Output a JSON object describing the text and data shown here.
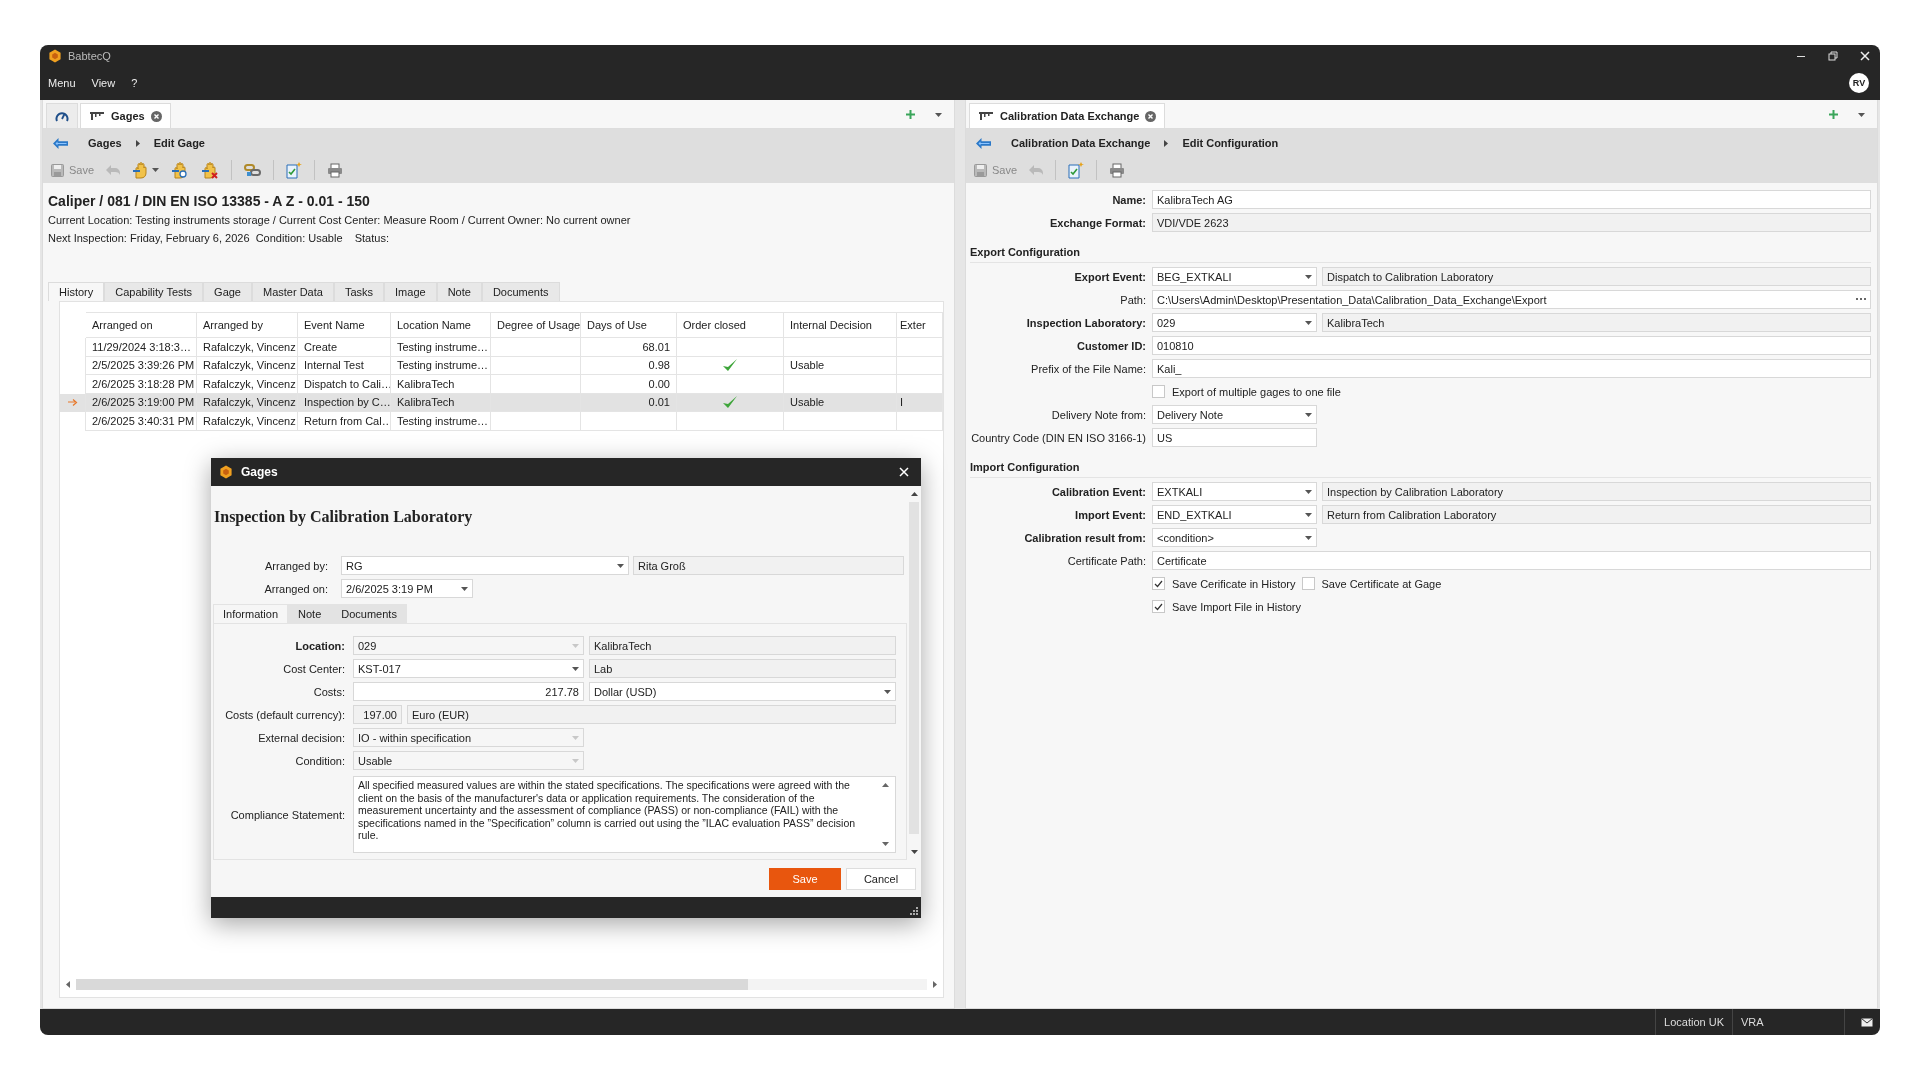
{
  "window": {
    "title": "BabtecQ",
    "menu": [
      "Menu",
      "View",
      "?"
    ],
    "avatar": "RV"
  },
  "gages_panel": {
    "tabs": [
      {
        "kind": "home",
        "selected": false
      },
      {
        "kind": "page",
        "label": "Gages",
        "selected": true
      }
    ],
    "breadcrumb": [
      "Gages",
      "Edit Gage"
    ],
    "toolbar": {
      "save": "Save"
    },
    "heading": "Caliper / 081 / DIN EN ISO 13385 - A Z - 0.01 - 150",
    "info_lines": [
      "Current Location: Testing instruments storage / Current Cost Center: Measure Room / Current Owner: No current owner",
      "Next Inspection: Friday, February 6, 2026  Condition: Usable    Status:"
    ],
    "detail_tabs": [
      {
        "label": "History",
        "selected": true
      },
      {
        "label": "Capability Tests",
        "selected": false
      },
      {
        "label": "Gage",
        "selected": false
      },
      {
        "label": "Master Data",
        "selected": false
      },
      {
        "label": "Tasks",
        "selected": false
      },
      {
        "label": "Image",
        "selected": false
      },
      {
        "label": "Note",
        "selected": false
      },
      {
        "label": "Documents",
        "selected": false
      }
    ],
    "table": {
      "columns": [
        "Arranged on",
        "Arranged by",
        "Event Name",
        "Location Name",
        "Degree of Usage",
        "Days of Use",
        "Order closed",
        "Internal Decision",
        "Exter"
      ],
      "rows": [
        {
          "arranged_on": "11/29/2024 3:18:3…",
          "arranged_by": "Rafalczyk, Vincenz",
          "event": "Create",
          "location": "Testing instrume…",
          "days": "68.01",
          "order_closed": false,
          "selected": false
        },
        {
          "arranged_on": "2/5/2025 3:39:26 PM",
          "arranged_by": "Rafalczyk, Vincenz",
          "event": "Internal Test",
          "location": "Testing instrume…",
          "days": "0.98",
          "order_closed": true,
          "decision": "Usable",
          "selected": false
        },
        {
          "arranged_on": "2/6/2025 3:18:28 PM",
          "arranged_by": "Rafalczyk, Vincenz",
          "event": "Dispatch to Cali…",
          "location": "KalibraTech",
          "days": "0.00",
          "order_closed": false,
          "selected": false
        },
        {
          "arranged_on": "2/6/2025 3:19:00 PM",
          "arranged_by": "Rafalczyk, Vincenz",
          "event": "Inspection by C…",
          "location": "KalibraTech",
          "days": "0.01",
          "order_closed": true,
          "decision": "Usable",
          "external": "I",
          "selected": true
        },
        {
          "arranged_on": "2/6/2025 3:40:31 PM",
          "arranged_by": "Rafalczyk, Vincenz",
          "event": "Return from Cal…",
          "location": "Testing instrume…",
          "order_closed": false,
          "selected": false
        }
      ]
    }
  },
  "dialog": {
    "title": "Gages",
    "heading": "Inspection by Calibration Laboratory",
    "arranged_by": {
      "label": "Arranged by:",
      "code": "RG",
      "name": "Rita Groß"
    },
    "arranged_on": {
      "label": "Arranged on:",
      "value": "2/6/2025 3:19 PM"
    },
    "tabs": [
      {
        "label": "Information",
        "selected": true
      },
      {
        "label": "Note",
        "selected": false
      },
      {
        "label": "Documents",
        "selected": false
      }
    ],
    "fields": [
      {
        "label": "Location:",
        "bold": true,
        "kind": "combo",
        "value": "029",
        "disabled": true,
        "extra": {
          "value": "KalibraTech",
          "kind": "readonly"
        }
      },
      {
        "label": "Cost Center:",
        "bold": false,
        "kind": "combo",
        "value": "KST-017",
        "disabled": false,
        "extra": {
          "value": "Lab",
          "kind": "readonly"
        }
      },
      {
        "label": "Costs:",
        "bold": false,
        "kind": "amount",
        "value": "217.78",
        "disabled": false,
        "extra": {
          "value": "Dollar (USD)",
          "kind": "combo"
        }
      },
      {
        "label": "Costs (default currency):",
        "bold": false,
        "kind": "short",
        "value": "197.00",
        "disabled": true,
        "extra": {
          "value": "Euro (EUR)",
          "kind": "readonly"
        }
      },
      {
        "label": "External decision:",
        "bold": false,
        "kind": "combo",
        "value": "IO - within specification",
        "disabled": true
      },
      {
        "label": "Condition:",
        "bold": false,
        "kind": "combo",
        "value": "Usable",
        "disabled": true
      }
    ],
    "compliance": {
      "label": "Compliance Statement:",
      "text": "All specified measured values are within the stated specifications. The specifications were agreed with the client on the basis of the manufacturer's data or application requirements. The consideration of the measurement uncertainty and the assessment of compliance (PASS) or non-compliance (FAIL) with the specifications named in the ”Specification” column is carried out using the ”ILAC evaluation PASS” decision rule."
    },
    "buttons": [
      {
        "label": "Save",
        "kind": "primary"
      },
      {
        "label": "Cancel",
        "kind": "secondary"
      }
    ]
  },
  "cde_panel": {
    "tabs": [
      {
        "kind": "page",
        "label": "Calibration Data Exchange",
        "selected": true
      }
    ],
    "breadcrumb": [
      "Calibration Data Exchange",
      "Edit Configuration"
    ],
    "toolbar": {
      "save": "Save"
    },
    "rows": [
      {
        "kind": "text",
        "label": "Name:",
        "bold": true,
        "value": "KalibraTech AG"
      },
      {
        "kind": "readonly",
        "label": "Exchange Format:",
        "bold": true,
        "value": "VDI/VDE 2623"
      },
      {
        "kind": "section",
        "label": "Export Configuration"
      },
      {
        "kind": "combo",
        "label": "Export Event:",
        "bold": true,
        "value": "BEG_EXTKALI",
        "extra": "Dispatch to Calibration Laboratory"
      },
      {
        "kind": "path",
        "label": "Path:",
        "bold": false,
        "value": "C:\\Users\\Admin\\Desktop\\Presentation_Data\\Calibration_Data_Exchange\\Export"
      },
      {
        "kind": "combo",
        "label": "Inspection Laboratory:",
        "bold": true,
        "value": "029",
        "extra": "KalibraTech"
      },
      {
        "kind": "text",
        "label": "Customer ID:",
        "bold": true,
        "value": "010810"
      },
      {
        "kind": "text",
        "label": "Prefix of the File Name:",
        "bold": false,
        "value": "Kali_"
      },
      {
        "kind": "checks",
        "items": [
          {
            "label": "Export of multiple gages to one file",
            "checked": false
          }
        ]
      },
      {
        "kind": "combo",
        "label": "Delivery Note from:",
        "bold": false,
        "value": "Delivery Note"
      },
      {
        "kind": "short",
        "label": "Country Code (DIN EN ISO 3166-1)",
        "bold": false,
        "value": "US"
      },
      {
        "kind": "section",
        "label": "Import Configuration"
      },
      {
        "kind": "combo",
        "label": "Calibration Event:",
        "bold": true,
        "value": "EXTKALI",
        "extra": "Inspection by Calibration Laboratory"
      },
      {
        "kind": "combo",
        "label": "Import Event:",
        "bold": true,
        "value": "END_EXTKALI",
        "extra": "Return from Calibration Laboratory"
      },
      {
        "kind": "combo",
        "label": "Calibration result from:",
        "bold": true,
        "value": "<condition>"
      },
      {
        "kind": "text",
        "label": "Certificate Path:",
        "bold": false,
        "value": "Certificate"
      },
      {
        "kind": "checks",
        "items": [
          {
            "label": "Save Cerificate in History",
            "checked": true
          },
          {
            "label": "Save Certificate at Gage",
            "checked": false
          }
        ]
      },
      {
        "kind": "checks",
        "items": [
          {
            "label": "Save Import File in History",
            "checked": true
          }
        ]
      }
    ]
  },
  "status_bar": {
    "items": [
      "Location UK",
      "VRA"
    ]
  }
}
